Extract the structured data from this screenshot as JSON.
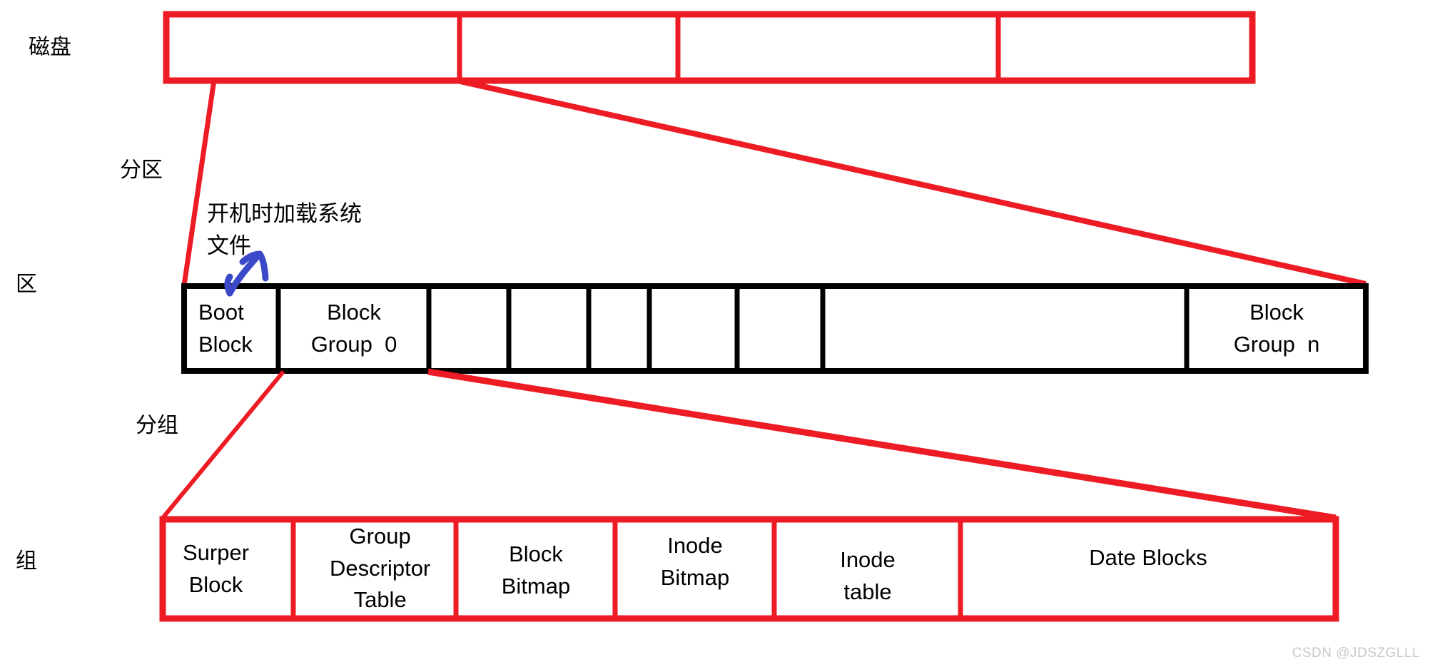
{
  "diagram": {
    "title_note": "开机时加载系统文件",
    "watermark": "CSDN @JDSZGLLL",
    "colors": {
      "red": "#ED1C24",
      "black": "#000000",
      "blue": "#3B49C8",
      "watermark": "#c9c9c9"
    },
    "side_labels": [
      {
        "text": "磁盘",
        "name": "label-disk"
      },
      {
        "text": "分区",
        "name": "label-partition"
      },
      {
        "text": "区",
        "name": "label-area"
      },
      {
        "text": "分组",
        "name": "label-grouping"
      },
      {
        "text": "组",
        "name": "label-group"
      }
    ],
    "disk_row": {
      "name": "disk-row",
      "cells": [
        {
          "label": ""
        },
        {
          "label": ""
        },
        {
          "label": ""
        },
        {
          "label": ""
        }
      ]
    },
    "partition_row": {
      "name": "partition-row",
      "cells": [
        {
          "line1": "Boot",
          "line2": "Block"
        },
        {
          "line1": "Block",
          "line2": "Group  0"
        },
        {
          "line1": "",
          "line2": ""
        },
        {
          "line1": "",
          "line2": ""
        },
        {
          "line1": "",
          "line2": ""
        },
        {
          "line1": "",
          "line2": ""
        },
        {
          "line1": "",
          "line2": ""
        },
        {
          "line1": "",
          "line2": ""
        },
        {
          "line1": "Block",
          "line2": "Group  n"
        }
      ]
    },
    "group_row": {
      "name": "block-group-row",
      "cells": [
        {
          "lines": "Surper\nBlock"
        },
        {
          "lines": "Group\nDescriptor\nTable"
        },
        {
          "lines": "Block\nBitmap"
        },
        {
          "lines": "Inode\nBitmap"
        },
        {
          "lines": "Inode\ntable"
        },
        {
          "lines": "Date Blocks"
        }
      ]
    }
  }
}
